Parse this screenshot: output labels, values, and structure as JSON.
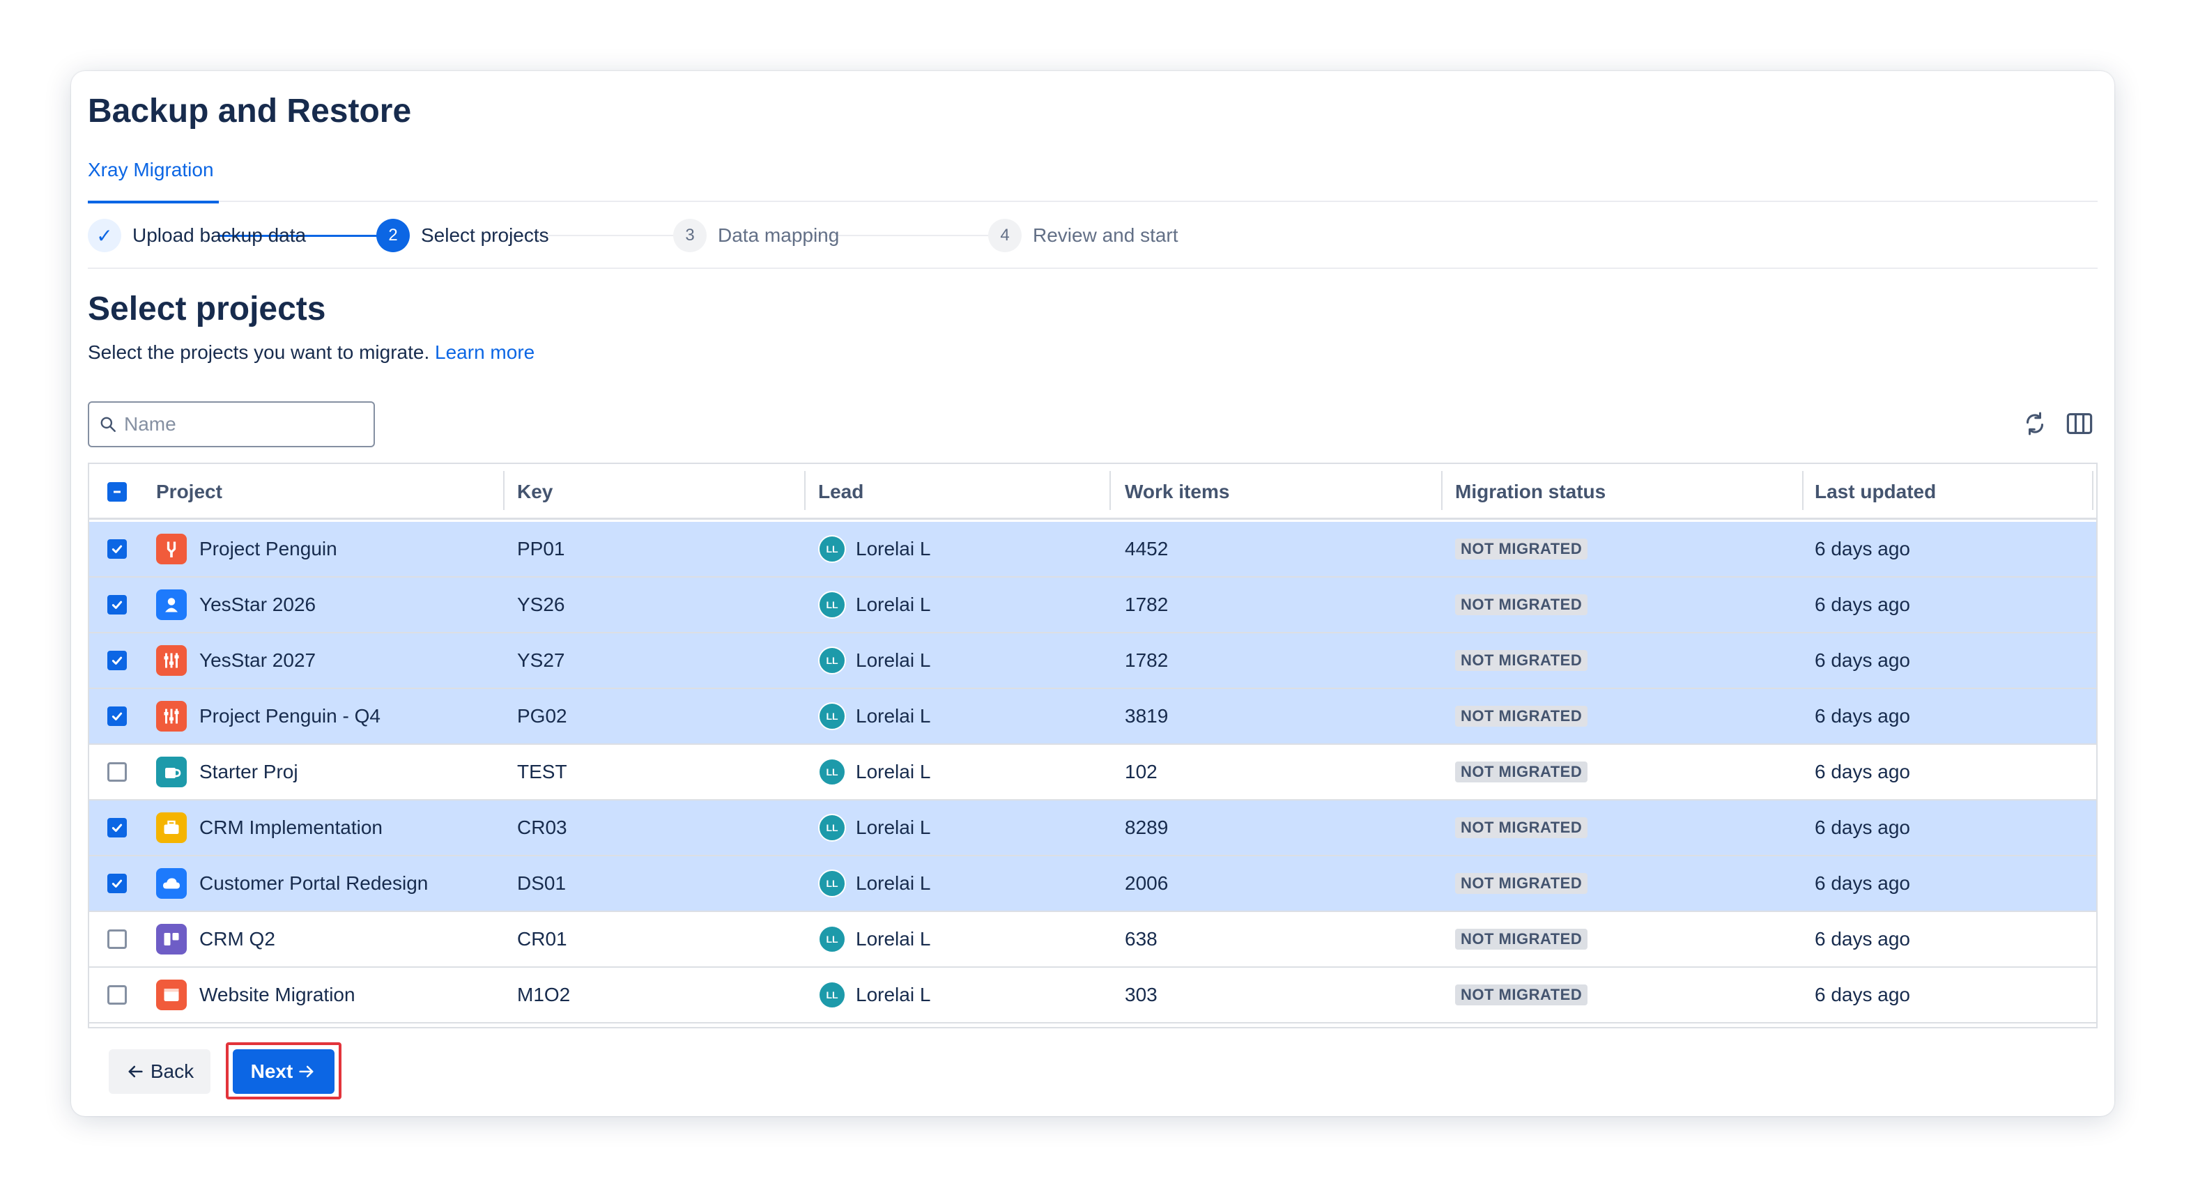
{
  "page": {
    "title": "Backup and Restore",
    "tab": "Xray Migration"
  },
  "stepper": {
    "steps": [
      {
        "number": "✓",
        "label": "Upload backup data",
        "state": "done"
      },
      {
        "number": "2",
        "label": "Select projects",
        "state": "active"
      },
      {
        "number": "3",
        "label": "Data mapping",
        "state": "todo"
      },
      {
        "number": "4",
        "label": "Review and start",
        "state": "todo"
      }
    ]
  },
  "section": {
    "title": "Select projects",
    "description": "Select the projects you want to migrate.",
    "learn_more": "Learn more"
  },
  "search": {
    "placeholder": "Name",
    "value": ""
  },
  "table": {
    "columns": [
      "Project",
      "Key",
      "Lead",
      "Work items",
      "Migration status",
      "Last updated"
    ],
    "rows": [
      {
        "selected": true,
        "project": "Project Penguin",
        "icon": "wrench-icon",
        "icon_color": "#f15b3b",
        "key": "PP01",
        "lead_initials": "LL",
        "lead": "Lorelai L",
        "work_items": "4452",
        "status": "NOT MIGRATED",
        "updated": "6 days ago"
      },
      {
        "selected": true,
        "project": "YesStar 2026",
        "icon": "person-icon",
        "icon_color": "#1d7afc",
        "key": "YS26",
        "lead_initials": "LL",
        "lead": "Lorelai L",
        "work_items": "1782",
        "status": "NOT MIGRATED",
        "updated": "6 days ago"
      },
      {
        "selected": true,
        "project": "YesStar 2027",
        "icon": "sliders-icon",
        "icon_color": "#f15b3b",
        "key": "YS27",
        "lead_initials": "LL",
        "lead": "Lorelai L",
        "work_items": "1782",
        "status": "NOT MIGRATED",
        "updated": "6 days ago"
      },
      {
        "selected": true,
        "project": "Project Penguin - Q4",
        "icon": "sliders-icon",
        "icon_color": "#f15b3b",
        "key": "PG02",
        "lead_initials": "LL",
        "lead": "Lorelai L",
        "work_items": "3819",
        "status": "NOT MIGRATED",
        "updated": "6 days ago"
      },
      {
        "selected": false,
        "project": "Starter Proj",
        "icon": "mug-icon",
        "icon_color": "#1d9aaa",
        "key": "TEST",
        "lead_initials": "LL",
        "lead": "Lorelai L",
        "work_items": "102",
        "status": "NOT MIGRATED",
        "updated": "6 days ago"
      },
      {
        "selected": true,
        "project": "CRM Implementation",
        "icon": "briefcase-icon",
        "icon_color": "#f5b400",
        "key": "CR03",
        "lead_initials": "LL",
        "lead": "Lorelai L",
        "work_items": "8289",
        "status": "NOT MIGRATED",
        "updated": "6 days ago"
      },
      {
        "selected": true,
        "project": "Customer Portal Redesign",
        "icon": "cloud-icon",
        "icon_color": "#1d7afc",
        "key": "DS01",
        "lead_initials": "LL",
        "lead": "Lorelai L",
        "work_items": "2006",
        "status": "NOT MIGRATED",
        "updated": "6 days ago"
      },
      {
        "selected": false,
        "project": "CRM Q2",
        "icon": "board-icon",
        "icon_color": "#6e5dc6",
        "key": "CR01",
        "lead_initials": "LL",
        "lead": "Lorelai L",
        "work_items": "638",
        "status": "NOT MIGRATED",
        "updated": "6 days ago"
      },
      {
        "selected": false,
        "project": "Website Migration",
        "icon": "browser-icon",
        "icon_color": "#f15b3b",
        "key": "M1O2",
        "lead_initials": "LL",
        "lead": "Lorelai L",
        "work_items": "303",
        "status": "NOT MIGRATED",
        "updated": "6 days ago"
      }
    ]
  },
  "footer": {
    "back_label": "Back",
    "next_label": "Next"
  },
  "colors": {
    "accent": "#0c66e4",
    "row_selected": "#cce0ff",
    "highlight": "#e2343b"
  }
}
